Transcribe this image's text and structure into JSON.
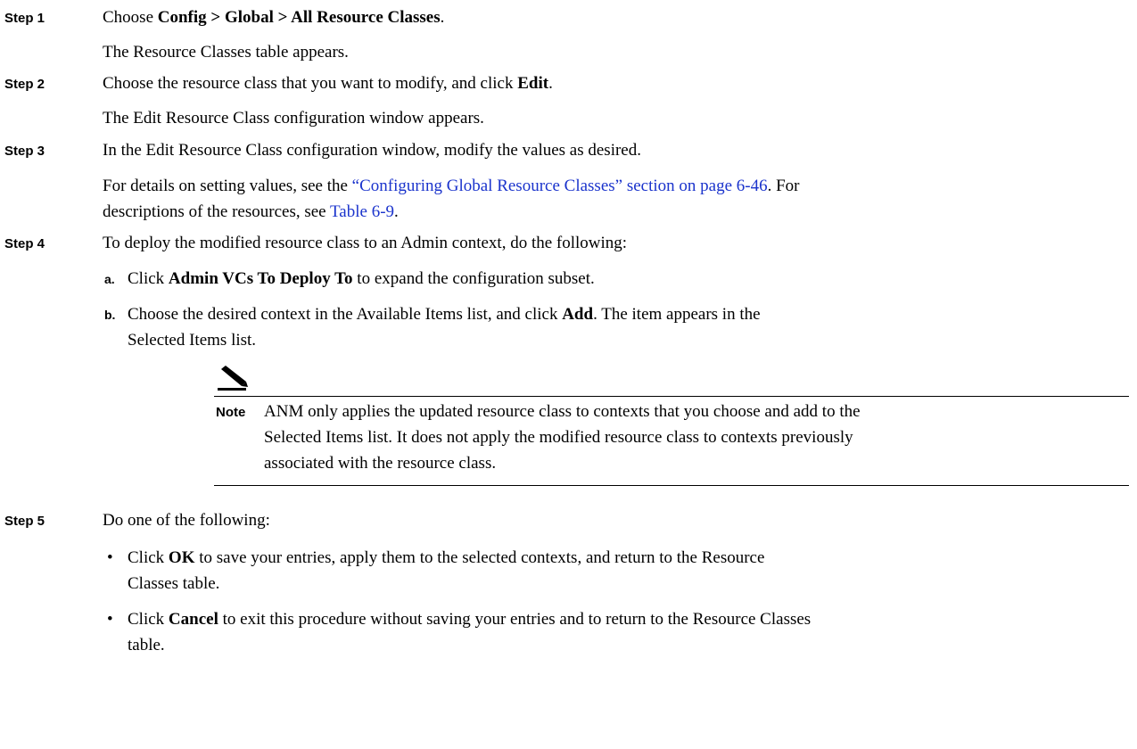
{
  "steps": [
    {
      "label": "Step 1",
      "text_parts": [
        "Choose ",
        "Config > Global > All Resource Classes",
        "."
      ],
      "result": "The Resource Classes table appears."
    },
    {
      "label": "Step 2",
      "text_parts": [
        "Choose the resource class that you want to modify, and click ",
        "Edit",
        "."
      ],
      "result": "The Edit Resource Class configuration window appears."
    },
    {
      "label": "Step 3",
      "text": "In the Edit Resource Class configuration window, modify the values as desired.",
      "details_line1_prefix": "For details on setting values, see the ",
      "details_link": "“Configuring Global Resource Classes” section on page 6-46",
      "details_line1_suffix": ". For",
      "details_line2_prefix": "descriptions of the resources, see ",
      "details_table_link": "Table 6-9",
      "details_line2_suffix": "."
    },
    {
      "label": "Step 4",
      "text": "To deploy the modified resource class to an Admin context, do the following:",
      "substeps": [
        {
          "label": "a.",
          "parts": [
            "Click ",
            "Admin VCs To Deploy To",
            " to expand the configuration subset."
          ]
        },
        {
          "label": "b.",
          "line1_parts": [
            "Choose the desired context in the Available Items list, and click ",
            "Add",
            ". The item appears in the"
          ],
          "line2": "Selected Items list."
        }
      ],
      "note": {
        "label": "Note",
        "lines": [
          "ANM only applies the updated resource class to contexts that you choose and add to the",
          "Selected Items list. It does not apply the modified resource class to contexts previously",
          "associated with the resource class."
        ]
      }
    },
    {
      "label": "Step 5",
      "text": "Do one of the following:",
      "bullets": [
        {
          "line1_parts": [
            "Click ",
            "OK",
            " to save your entries, apply them to the selected contexts, and return to the Resource"
          ],
          "line2": "Classes table."
        },
        {
          "line1_parts": [
            "Click ",
            "Cancel",
            " to exit this procedure without saving your entries and to return to the Resource Classes"
          ],
          "line2": "table."
        }
      ]
    }
  ],
  "icons": {
    "note": "pencil-note-icon",
    "bullet": "•"
  }
}
